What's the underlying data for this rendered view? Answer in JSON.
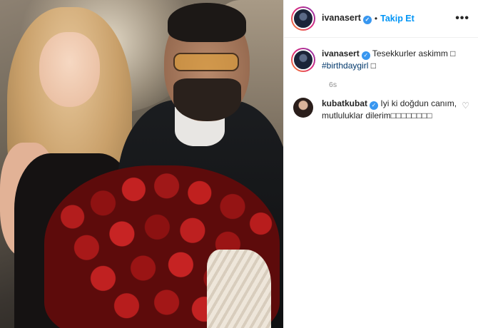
{
  "post": {
    "photo_alt": "",
    "header": {
      "username": "ivanasert",
      "separator": "•",
      "follow_label": "Takip Et",
      "more_label": "•••"
    },
    "caption": {
      "username": "ivanasert",
      "text": "Tesekkurler askimm □",
      "hashtag": "#birthdaygirl",
      "after_hashtag": " □",
      "time": "6s"
    },
    "comments": [
      {
        "username": "kubatkubat",
        "text": "Iyi ki doğdun canım, mutluluklar dilerim□□□□□□□□"
      }
    ],
    "icons": {
      "verified": "verified-badge-icon",
      "more": "more-options-icon",
      "like": "heart-icon"
    },
    "colors": {
      "follow": "#0095f6",
      "verified": "#3897f0",
      "hashtag": "#00376b",
      "muted": "#8e8e8e"
    }
  }
}
